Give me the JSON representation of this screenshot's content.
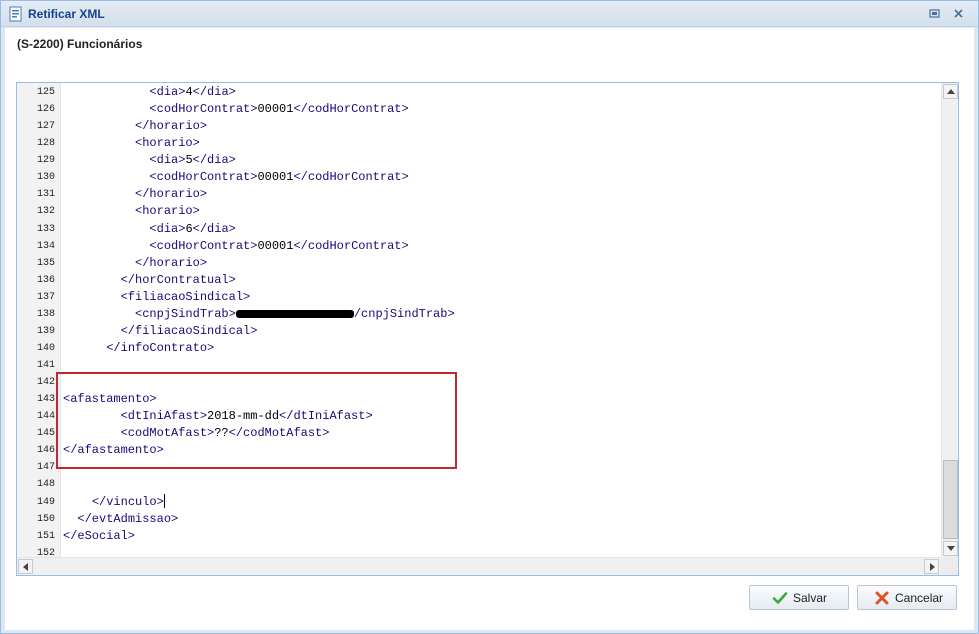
{
  "window": {
    "title": "Retificar XML",
    "subtitle": "(S-2200) Funcionários"
  },
  "icons": {
    "app": "xml-document-icon",
    "restore": "restore-window-icon",
    "close": "close-icon",
    "save": "checkmark-icon",
    "cancel": "x-icon"
  },
  "colors": {
    "tag": "#170a7a",
    "highlight": "#c1272d",
    "save_icon": "#3aa83a",
    "cancel_icon": "#e0502a"
  },
  "editor": {
    "highlight_lines": [
      143,
      146
    ],
    "lines": [
      {
        "n": "125",
        "indent": "            ",
        "parts": [
          {
            "t": "tag",
            "v": "<dia>"
          },
          {
            "t": "txt",
            "v": "4"
          },
          {
            "t": "tag",
            "v": "</dia>"
          }
        ]
      },
      {
        "n": "126",
        "indent": "            ",
        "parts": [
          {
            "t": "tag",
            "v": "<codHorContrat>"
          },
          {
            "t": "txt",
            "v": "00001"
          },
          {
            "t": "tag",
            "v": "</codHorContrat>"
          }
        ]
      },
      {
        "n": "127",
        "indent": "          ",
        "parts": [
          {
            "t": "tag",
            "v": "</horario>"
          }
        ]
      },
      {
        "n": "128",
        "indent": "          ",
        "parts": [
          {
            "t": "tag",
            "v": "<horario>"
          }
        ]
      },
      {
        "n": "129",
        "indent": "            ",
        "parts": [
          {
            "t": "tag",
            "v": "<dia>"
          },
          {
            "t": "txt",
            "v": "5"
          },
          {
            "t": "tag",
            "v": "</dia>"
          }
        ]
      },
      {
        "n": "130",
        "indent": "            ",
        "parts": [
          {
            "t": "tag",
            "v": "<codHorContrat>"
          },
          {
            "t": "txt",
            "v": "00001"
          },
          {
            "t": "tag",
            "v": "</codHorContrat>"
          }
        ]
      },
      {
        "n": "131",
        "indent": "          ",
        "parts": [
          {
            "t": "tag",
            "v": "</horario>"
          }
        ]
      },
      {
        "n": "132",
        "indent": "          ",
        "parts": [
          {
            "t": "tag",
            "v": "<horario>"
          }
        ]
      },
      {
        "n": "133",
        "indent": "            ",
        "parts": [
          {
            "t": "tag",
            "v": "<dia>"
          },
          {
            "t": "txt",
            "v": "6"
          },
          {
            "t": "tag",
            "v": "</dia>"
          }
        ]
      },
      {
        "n": "134",
        "indent": "            ",
        "parts": [
          {
            "t": "tag",
            "v": "<codHorContrat>"
          },
          {
            "t": "txt",
            "v": "00001"
          },
          {
            "t": "tag",
            "v": "</codHorContrat>"
          }
        ]
      },
      {
        "n": "135",
        "indent": "          ",
        "parts": [
          {
            "t": "tag",
            "v": "</horario>"
          }
        ]
      },
      {
        "n": "136",
        "indent": "        ",
        "parts": [
          {
            "t": "tag",
            "v": "</horContratual>"
          }
        ]
      },
      {
        "n": "137",
        "indent": "        ",
        "parts": [
          {
            "t": "tag",
            "v": "<filiacaoSindical>"
          }
        ]
      },
      {
        "n": "138",
        "indent": "          ",
        "parts": [
          {
            "t": "tag",
            "v": "<cnpjSindTrab>"
          },
          {
            "t": "redact",
            "v": ""
          },
          {
            "t": "tag",
            "v": "/cnpjSindTrab>"
          }
        ]
      },
      {
        "n": "139",
        "indent": "        ",
        "parts": [
          {
            "t": "tag",
            "v": "</filiacaoSindical>"
          }
        ]
      },
      {
        "n": "140",
        "indent": "      ",
        "parts": [
          {
            "t": "tag",
            "v": "</infoContrato>"
          }
        ]
      },
      {
        "n": "141",
        "indent": "",
        "parts": []
      },
      {
        "n": "142",
        "indent": "",
        "parts": []
      },
      {
        "n": "143",
        "indent": "",
        "parts": [
          {
            "t": "tag",
            "v": "<afastamento>"
          }
        ]
      },
      {
        "n": "144",
        "indent": "        ",
        "parts": [
          {
            "t": "tag",
            "v": "<dtIniAfast>"
          },
          {
            "t": "txt",
            "v": "2018-mm-dd"
          },
          {
            "t": "tag",
            "v": "</dtIniAfast>"
          }
        ]
      },
      {
        "n": "145",
        "indent": "        ",
        "parts": [
          {
            "t": "tag",
            "v": "<codMotAfast>"
          },
          {
            "t": "txt",
            "v": "??"
          },
          {
            "t": "tag",
            "v": "</codMotAfast>"
          }
        ]
      },
      {
        "n": "146",
        "indent": "",
        "parts": [
          {
            "t": "tag",
            "v": "</afastamento>"
          }
        ]
      },
      {
        "n": "147",
        "indent": "",
        "parts": []
      },
      {
        "n": "148",
        "indent": "",
        "parts": []
      },
      {
        "n": "149",
        "indent": "    ",
        "parts": [
          {
            "t": "tag",
            "v": "</vinculo>"
          },
          {
            "t": "cursor",
            "v": ""
          }
        ]
      },
      {
        "n": "150",
        "indent": "  ",
        "parts": [
          {
            "t": "tag",
            "v": "</evtAdmissao>"
          }
        ]
      },
      {
        "n": "151",
        "indent": "",
        "parts": [
          {
            "t": "tag",
            "v": "</eSocial>"
          }
        ]
      },
      {
        "n": "152",
        "indent": "",
        "parts": []
      }
    ]
  },
  "buttons": {
    "save_label": "Salvar",
    "cancel_label": "Cancelar"
  }
}
